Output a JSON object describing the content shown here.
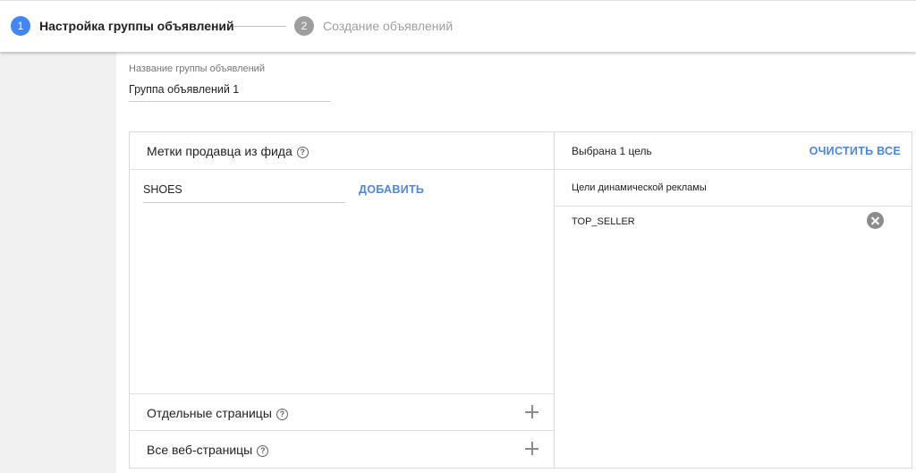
{
  "stepper": {
    "steps": [
      {
        "number": "1",
        "label": "Настройка группы объявлений",
        "state": "active"
      },
      {
        "number": "2",
        "label": "Создание объявлений",
        "state": "inactive"
      }
    ]
  },
  "ad_group": {
    "name_label": "Название группы объявлений",
    "name_value": "Группа объявлений 1"
  },
  "left_panel": {
    "title": "Метки продавца из фида",
    "input_value": "SHOES",
    "add_label": "ДОБАВИТЬ",
    "rows": [
      {
        "label": "Отдельные страницы"
      },
      {
        "label": "Все веб-страницы"
      }
    ]
  },
  "right_panel": {
    "selected_text": "Выбрана 1 цель",
    "clear_all_label": "ОЧИСТИТЬ ВСЕ",
    "section_label": "Цели динамической рекламы",
    "items": [
      {
        "label": "TOP_SELLER"
      }
    ]
  },
  "colors": {
    "accent": "#4285f4",
    "link": "#4a86e8",
    "inactive": "#9e9e9e",
    "background": "#f1f1f1"
  },
  "icons": [
    "help-icon",
    "plus-icon",
    "remove-icon"
  ]
}
